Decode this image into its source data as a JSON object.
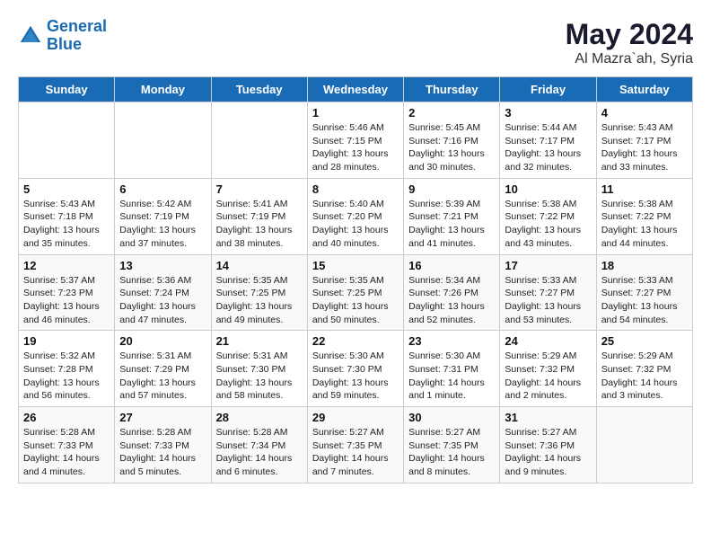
{
  "header": {
    "logo_line1": "General",
    "logo_line2": "Blue",
    "title": "May 2024",
    "subtitle": "Al Mazra`ah, Syria"
  },
  "days_of_week": [
    "Sunday",
    "Monday",
    "Tuesday",
    "Wednesday",
    "Thursday",
    "Friday",
    "Saturday"
  ],
  "weeks": [
    [
      {
        "day": "",
        "info": ""
      },
      {
        "day": "",
        "info": ""
      },
      {
        "day": "",
        "info": ""
      },
      {
        "day": "1",
        "info": "Sunrise: 5:46 AM\nSunset: 7:15 PM\nDaylight: 13 hours\nand 28 minutes."
      },
      {
        "day": "2",
        "info": "Sunrise: 5:45 AM\nSunset: 7:16 PM\nDaylight: 13 hours\nand 30 minutes."
      },
      {
        "day": "3",
        "info": "Sunrise: 5:44 AM\nSunset: 7:17 PM\nDaylight: 13 hours\nand 32 minutes."
      },
      {
        "day": "4",
        "info": "Sunrise: 5:43 AM\nSunset: 7:17 PM\nDaylight: 13 hours\nand 33 minutes."
      }
    ],
    [
      {
        "day": "5",
        "info": "Sunrise: 5:43 AM\nSunset: 7:18 PM\nDaylight: 13 hours\nand 35 minutes."
      },
      {
        "day": "6",
        "info": "Sunrise: 5:42 AM\nSunset: 7:19 PM\nDaylight: 13 hours\nand 37 minutes."
      },
      {
        "day": "7",
        "info": "Sunrise: 5:41 AM\nSunset: 7:19 PM\nDaylight: 13 hours\nand 38 minutes."
      },
      {
        "day": "8",
        "info": "Sunrise: 5:40 AM\nSunset: 7:20 PM\nDaylight: 13 hours\nand 40 minutes."
      },
      {
        "day": "9",
        "info": "Sunrise: 5:39 AM\nSunset: 7:21 PM\nDaylight: 13 hours\nand 41 minutes."
      },
      {
        "day": "10",
        "info": "Sunrise: 5:38 AM\nSunset: 7:22 PM\nDaylight: 13 hours\nand 43 minutes."
      },
      {
        "day": "11",
        "info": "Sunrise: 5:38 AM\nSunset: 7:22 PM\nDaylight: 13 hours\nand 44 minutes."
      }
    ],
    [
      {
        "day": "12",
        "info": "Sunrise: 5:37 AM\nSunset: 7:23 PM\nDaylight: 13 hours\nand 46 minutes."
      },
      {
        "day": "13",
        "info": "Sunrise: 5:36 AM\nSunset: 7:24 PM\nDaylight: 13 hours\nand 47 minutes."
      },
      {
        "day": "14",
        "info": "Sunrise: 5:35 AM\nSunset: 7:25 PM\nDaylight: 13 hours\nand 49 minutes."
      },
      {
        "day": "15",
        "info": "Sunrise: 5:35 AM\nSunset: 7:25 PM\nDaylight: 13 hours\nand 50 minutes."
      },
      {
        "day": "16",
        "info": "Sunrise: 5:34 AM\nSunset: 7:26 PM\nDaylight: 13 hours\nand 52 minutes."
      },
      {
        "day": "17",
        "info": "Sunrise: 5:33 AM\nSunset: 7:27 PM\nDaylight: 13 hours\nand 53 minutes."
      },
      {
        "day": "18",
        "info": "Sunrise: 5:33 AM\nSunset: 7:27 PM\nDaylight: 13 hours\nand 54 minutes."
      }
    ],
    [
      {
        "day": "19",
        "info": "Sunrise: 5:32 AM\nSunset: 7:28 PM\nDaylight: 13 hours\nand 56 minutes."
      },
      {
        "day": "20",
        "info": "Sunrise: 5:31 AM\nSunset: 7:29 PM\nDaylight: 13 hours\nand 57 minutes."
      },
      {
        "day": "21",
        "info": "Sunrise: 5:31 AM\nSunset: 7:30 PM\nDaylight: 13 hours\nand 58 minutes."
      },
      {
        "day": "22",
        "info": "Sunrise: 5:30 AM\nSunset: 7:30 PM\nDaylight: 13 hours\nand 59 minutes."
      },
      {
        "day": "23",
        "info": "Sunrise: 5:30 AM\nSunset: 7:31 PM\nDaylight: 14 hours\nand 1 minute."
      },
      {
        "day": "24",
        "info": "Sunrise: 5:29 AM\nSunset: 7:32 PM\nDaylight: 14 hours\nand 2 minutes."
      },
      {
        "day": "25",
        "info": "Sunrise: 5:29 AM\nSunset: 7:32 PM\nDaylight: 14 hours\nand 3 minutes."
      }
    ],
    [
      {
        "day": "26",
        "info": "Sunrise: 5:28 AM\nSunset: 7:33 PM\nDaylight: 14 hours\nand 4 minutes."
      },
      {
        "day": "27",
        "info": "Sunrise: 5:28 AM\nSunset: 7:33 PM\nDaylight: 14 hours\nand 5 minutes."
      },
      {
        "day": "28",
        "info": "Sunrise: 5:28 AM\nSunset: 7:34 PM\nDaylight: 14 hours\nand 6 minutes."
      },
      {
        "day": "29",
        "info": "Sunrise: 5:27 AM\nSunset: 7:35 PM\nDaylight: 14 hours\nand 7 minutes."
      },
      {
        "day": "30",
        "info": "Sunrise: 5:27 AM\nSunset: 7:35 PM\nDaylight: 14 hours\nand 8 minutes."
      },
      {
        "day": "31",
        "info": "Sunrise: 5:27 AM\nSunset: 7:36 PM\nDaylight: 14 hours\nand 9 minutes."
      },
      {
        "day": "",
        "info": ""
      }
    ]
  ]
}
